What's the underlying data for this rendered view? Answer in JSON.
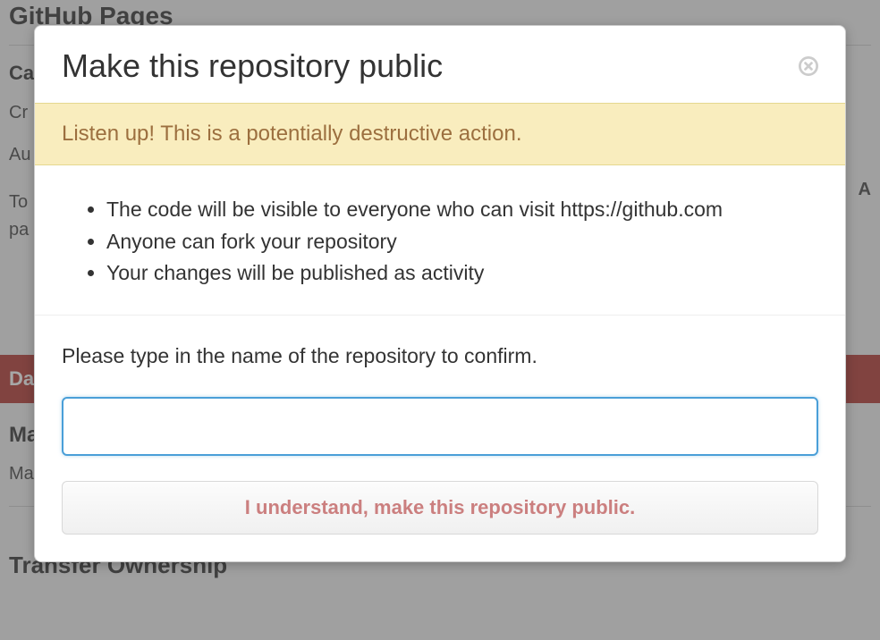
{
  "background": {
    "pages_heading": "GitHub Pages",
    "custom_label": "Ca",
    "create_text": "Cr",
    "auto_label": "Au",
    "to_text": "To",
    "pa_text": "pa",
    "danger_label": "Da",
    "make_heading": "Ma",
    "make_text": "Ma",
    "right_a": "A",
    "transfer_heading": "Transfer Ownership"
  },
  "modal": {
    "title": "Make this repository public",
    "alert_text": "Listen up! This is a potentially destructive action.",
    "bullets": [
      "The code will be visible to everyone who can visit https://github.com",
      "Anyone can fork your repository",
      "Your changes will be published as activity"
    ],
    "confirm_label": "Please type in the name of the repository to confirm.",
    "input_value": "",
    "confirm_button": "I understand, make this repository public."
  }
}
